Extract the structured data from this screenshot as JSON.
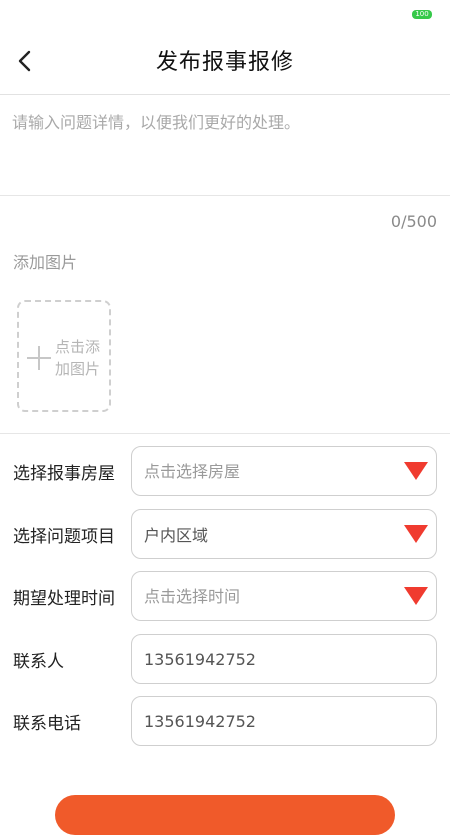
{
  "status_bar": {
    "battery": "100"
  },
  "header": {
    "title": "发布报事报修"
  },
  "description": {
    "placeholder": "请输入问题详情，以便我们更好的处理。",
    "counter": "0/500"
  },
  "images": {
    "label": "添加图片",
    "add_text": "点击添加图片"
  },
  "form": {
    "house": {
      "label": "选择报事房屋",
      "placeholder": "点击选择房屋",
      "value": ""
    },
    "item": {
      "label": "选择问题项目",
      "placeholder": "",
      "value": "户内区域"
    },
    "time": {
      "label": "期望处理时间",
      "placeholder": "点击选择时间",
      "value": ""
    },
    "contact": {
      "label": "联系人",
      "placeholder": "",
      "value": "13561942752"
    },
    "phone": {
      "label": "联系电话",
      "placeholder": "",
      "value": "13561942752"
    }
  },
  "colors": {
    "accent": "#f03b2f",
    "submit": "#f05a2a",
    "battery": "#36c94a"
  }
}
